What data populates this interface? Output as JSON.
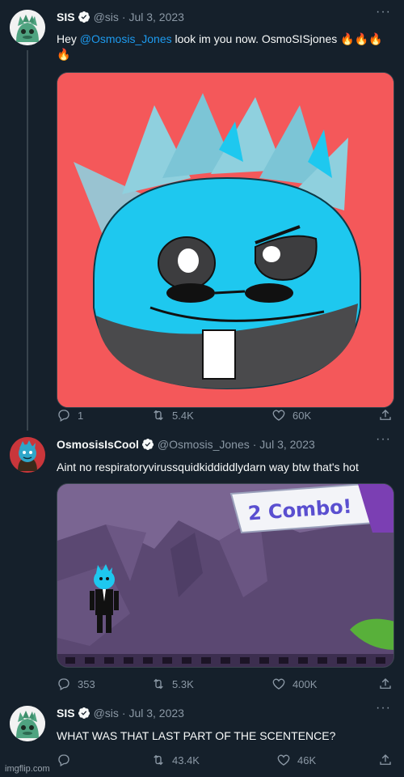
{
  "tweets": [
    {
      "name": "SIS",
      "handle": "@sis",
      "date": "· Jul 3, 2023",
      "text_before": "Hey ",
      "mention": "@Osmosis_Jones",
      "text_after": " look im you now. OsmoSISjones 🔥🔥🔥",
      "text_line2": "🔥",
      "replies": "1",
      "retweets": "5.4K",
      "likes": "60K",
      "avatar_color": "#f5f5f5"
    },
    {
      "name": "OsmosisIsCool",
      "handle": "@Osmosis_Jones",
      "date": "· Jul 3, 2023",
      "text": "Aint no respiratoryvirussquidkiddiddlydarn way btw that's hot",
      "media_banner": "2 Combo!",
      "replies": "353",
      "retweets": "5.3K",
      "likes": "400K"
    },
    {
      "name": "SIS",
      "handle": "@sis",
      "date": "· Jul 3, 2023",
      "text": "WHAT WAS THAT LAST PART OF THE SCENTENCE?",
      "replies": "",
      "retweets": "43.4K",
      "likes": "46K"
    }
  ],
  "more_label": "···",
  "watermark": "imgflip.com",
  "colors": {
    "background": "#15202b",
    "accent": "#1d9bf0",
    "muted": "#8b98a5",
    "pfp_red": "#f4585a",
    "cyan": "#1ec8ef"
  }
}
